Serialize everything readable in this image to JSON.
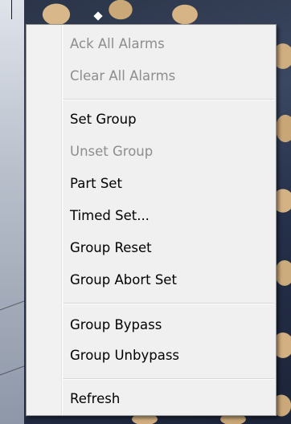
{
  "context_menu": {
    "items": [
      {
        "label": "Ack All Alarms",
        "enabled": false
      },
      {
        "label": "Clear All Alarms",
        "enabled": false
      },
      {
        "label": "Set Group",
        "enabled": true
      },
      {
        "label": "Unset Group",
        "enabled": false
      },
      {
        "label": "Part Set",
        "enabled": true
      },
      {
        "label": "Timed Set...",
        "enabled": true
      },
      {
        "label": "Group Reset",
        "enabled": true
      },
      {
        "label": "Group Abort Set",
        "enabled": true
      },
      {
        "label": "Group Bypass",
        "enabled": true
      },
      {
        "label": "Group Unbypass",
        "enabled": true
      },
      {
        "label": "Refresh",
        "enabled": true
      }
    ]
  },
  "colors": {
    "menu_background": "#f0f0f0",
    "enabled_text": "#000000",
    "disabled_text": "#8d8d8d",
    "separator": "#d7d7d7"
  }
}
